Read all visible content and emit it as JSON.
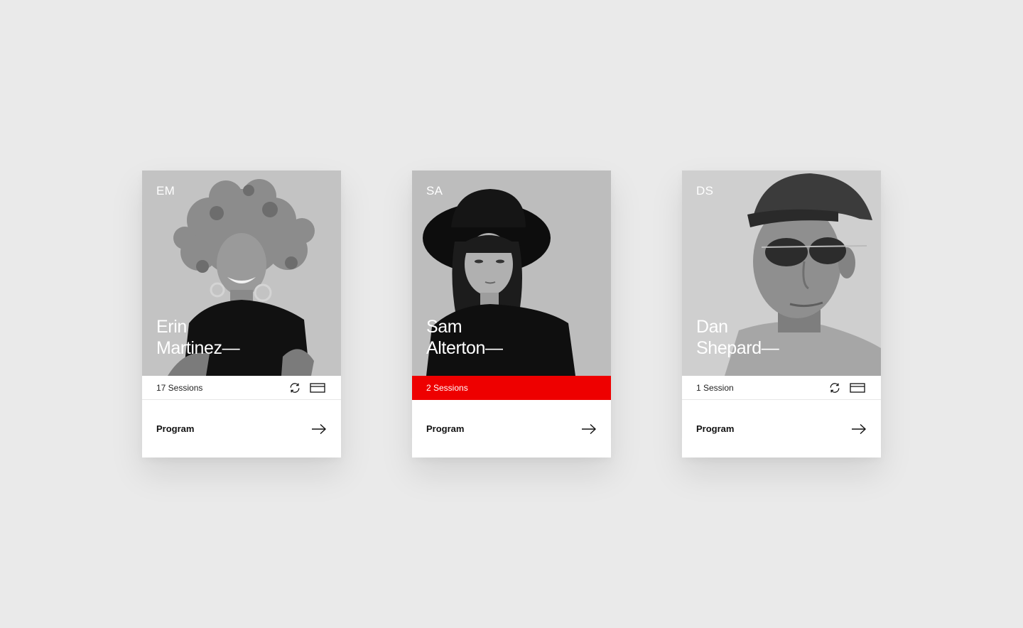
{
  "colors": {
    "background": "#eaeaea",
    "card": "#ffffff",
    "accent": "#ee0000",
    "text": "#111111"
  },
  "cards": [
    {
      "initials": "EM",
      "first_name": "Erin",
      "last_name": "Martinez—",
      "sessions": "17 Sessions",
      "highlighted": false,
      "cta": "Program",
      "icons": [
        "refresh-icon",
        "card-icon",
        "arrow-right-icon"
      ]
    },
    {
      "initials": "SA",
      "first_name": "Sam",
      "last_name": "Alterton—",
      "sessions": "2 Sessions",
      "highlighted": true,
      "cta": "Program",
      "icons": [
        "arrow-right-icon"
      ]
    },
    {
      "initials": "DS",
      "first_name": "Dan",
      "last_name": "Shepard—",
      "sessions": "1 Session",
      "highlighted": false,
      "cta": "Program",
      "icons": [
        "refresh-icon",
        "card-icon",
        "arrow-right-icon"
      ]
    }
  ]
}
